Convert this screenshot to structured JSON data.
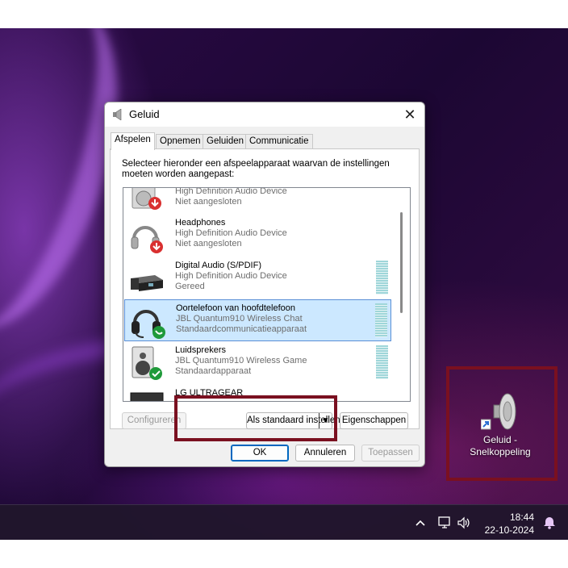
{
  "dialog": {
    "title": "Geluid",
    "close_label": "✕",
    "tabs": [
      "Afspelen",
      "Opnemen",
      "Geluiden",
      "Communicatie"
    ],
    "active_tab": "Afspelen",
    "instructions": "Selecteer hieronder een afspeelapparaat waarvan de instellingen moeten worden aangepast:",
    "devices": [
      {
        "name": "",
        "sub": "High Definition Audio Device",
        "status": "Niet aangesloten",
        "icon": "speaker-disconnected-icon"
      },
      {
        "name": "Headphones",
        "sub": "High Definition Audio Device",
        "status": "Niet aangesloten",
        "icon": "headphones-disconnected-icon"
      },
      {
        "name": "Digital Audio (S/PDIF)",
        "sub": "High Definition Audio Device",
        "status": "Gereed",
        "icon": "digital-audio-icon"
      },
      {
        "name": "Oortelefoon van hoofdtelefoon",
        "sub": "JBL Quantum910 Wireless Chat",
        "status": "Standaardcommunicatieapparaat",
        "icon": "headset-phone-icon"
      },
      {
        "name": "Luidsprekers",
        "sub": "JBL Quantum910 Wireless Game",
        "status": "Standaardapparaat",
        "icon": "speaker-default-icon"
      },
      {
        "name": "LG ULTRAGEAR",
        "sub": "",
        "status": "",
        "icon": "monitor-icon"
      }
    ],
    "buttons": {
      "configure": "Configureren",
      "set_default": "Als standaard instellen",
      "properties": "Eigenschappen",
      "ok": "OK",
      "cancel": "Annuleren",
      "apply": "Toepassen"
    }
  },
  "desktop": {
    "shortcut_label_line1": "Geluid -",
    "shortcut_label_line2": "Snelkoppeling"
  },
  "taskbar": {
    "time": "18:44",
    "date": "22-10-2024",
    "chevron": "^"
  },
  "colors": {
    "selection": "#cce8ff",
    "highlight_box": "#7a1020",
    "accent": "#0067c0"
  }
}
